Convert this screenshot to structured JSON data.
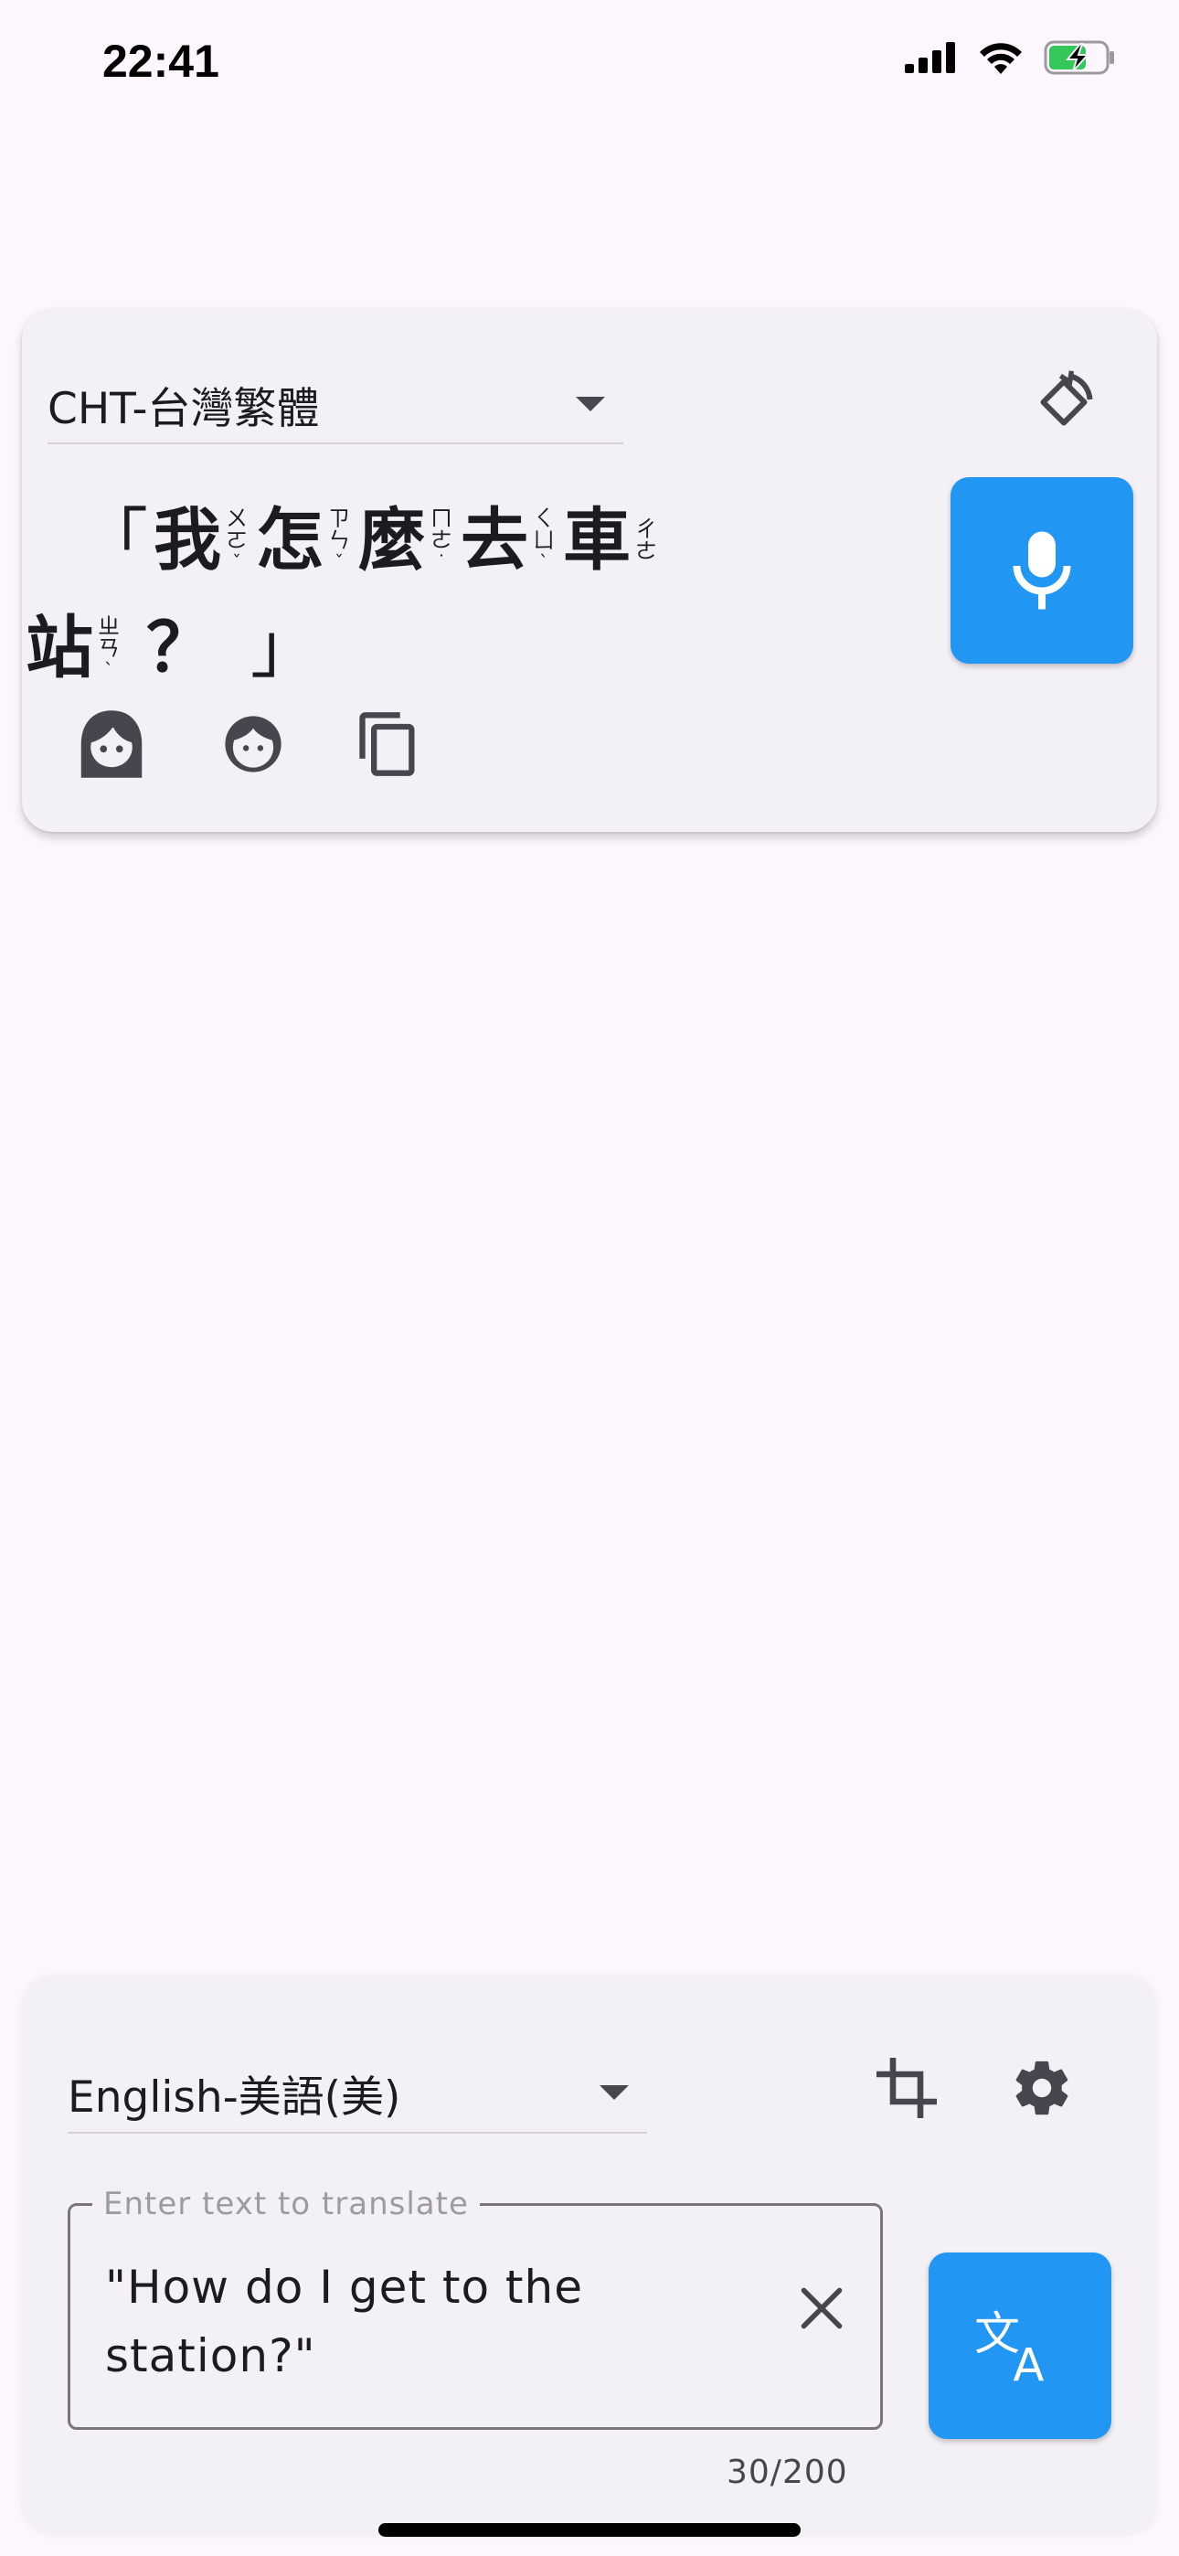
{
  "status_bar": {
    "time": "22:41",
    "icons": [
      "signal-icon",
      "wifi-icon",
      "battery-charging-icon"
    ]
  },
  "output_card": {
    "language": "CHT-台灣繁體",
    "rotate_icon": "rotate-icon",
    "mic_icon": "mic-icon",
    "phrase": {
      "open_bracket": "「",
      "close_bracket": "」",
      "line1": [
        {
          "char": "我",
          "bopomofo": "ㄨㄛ",
          "tone": "ˇ"
        },
        {
          "char": "怎",
          "bopomofo": "ㄗㄣ",
          "tone": "ˇ"
        },
        {
          "char": "麼",
          "bopomofo": "ㄇㄜ",
          "tone": "˙"
        },
        {
          "char": "去",
          "bopomofo": "ㄑㄩ",
          "tone": "ˋ"
        },
        {
          "char": "車",
          "bopomofo": "ㄔㄜ",
          "tone": ""
        }
      ],
      "line2": [
        {
          "char": "站",
          "bopomofo": "ㄓㄢ",
          "tone": "ˋ"
        }
      ],
      "question_mark": "？"
    },
    "voice_icons": [
      "female-voice-icon",
      "child-voice-icon",
      "copy-icon"
    ]
  },
  "input_card": {
    "language": "English-美語(美)",
    "crop_icon": "crop-icon",
    "settings_icon": "gear-icon",
    "input_label": "Enter text to translate",
    "input_value": "\"How do I get to the station?\"",
    "counter": "30/200",
    "translate_icon": "translate-icon"
  },
  "colors": {
    "accent": "#2196f3",
    "background": "#fdf7fd",
    "card": "#f4f1f6",
    "battery": "#34c759"
  }
}
